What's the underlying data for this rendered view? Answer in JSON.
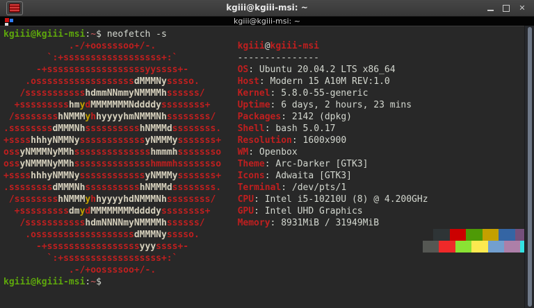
{
  "window": {
    "title": "kgiii@kgiii-msi: ~",
    "controls": {
      "minimize": "minimize",
      "maximize": "maximize",
      "close": "close"
    }
  },
  "tab": {
    "title": "kgiii@kgiii-msi: ~"
  },
  "icons": {
    "app_icon": "red-terminal-app-icon",
    "tab_icon": "terminal-tab-icon",
    "minimize_icon": "minimize-icon",
    "maximize_icon": "maximize-icon",
    "close_icon": "close-icon",
    "scrollbar": "vertical-scrollbar"
  },
  "terminal": {
    "colors": {
      "background": "#282828",
      "red": "#c01f1f",
      "cream": "#d6d0bc",
      "yellow": "#c4a000",
      "green": "#5ea70c",
      "path_color": "#cf5f5f",
      "foreground": "#d3d7cf"
    },
    "prompt": {
      "user_host": "kgiii@kgiii-msi",
      "separator": ":",
      "path": "~",
      "symbol": "$"
    },
    "command": " neofetch -s",
    "ascii_art_rows": [
      [
        [
          "r",
          "            .-/+oossssoo+/-."
        ]
      ],
      [
        [
          "r",
          "        `:+ssssssssssssssssss+:`"
        ]
      ],
      [
        [
          "r",
          "      -+ssssssssssssssssssyyssss+-"
        ]
      ],
      [
        [
          "r",
          "    .ossssssssssssssssss"
        ],
        [
          "w",
          "dMMMNy"
        ],
        [
          "r",
          "sssso."
        ]
      ],
      [
        [
          "r",
          "   /sssssssssss"
        ],
        [
          "w",
          "hdmmNNmmyNMMMMh"
        ],
        [
          "r",
          "ssssss/"
        ]
      ],
      [
        [
          "r",
          "  +sssssssss"
        ],
        [
          "w",
          "hm"
        ],
        [
          "y",
          "y"
        ],
        [
          "r",
          "d"
        ],
        [
          "w",
          "MMMMMMMNddddy"
        ],
        [
          "r",
          "ssssssss+"
        ]
      ],
      [
        [
          "r",
          " /ssssssss"
        ],
        [
          "w",
          "hNMMM"
        ],
        [
          "y",
          "y"
        ],
        [
          "r",
          "h"
        ],
        [
          "w",
          "hyyyyhmNMMMNh"
        ],
        [
          "r",
          "ssssssss/"
        ]
      ],
      [
        [
          "r",
          ".ssssssss"
        ],
        [
          "w",
          "dMMMNh"
        ],
        [
          "r",
          "ssssssssss"
        ],
        [
          "w",
          "hNMMMd"
        ],
        [
          "r",
          "ssssssss."
        ]
      ],
      [
        [
          "r",
          "+ssss"
        ],
        [
          "w",
          "hhhyNMMNy"
        ],
        [
          "r",
          "ssssssssssss"
        ],
        [
          "w",
          "yNMMMy"
        ],
        [
          "r",
          "sssssss+"
        ]
      ],
      [
        [
          "r",
          "oss"
        ],
        [
          "w",
          "yNMMMNyMMh"
        ],
        [
          "r",
          "ssssssssssssss"
        ],
        [
          "w",
          "hmmmh"
        ],
        [
          "r",
          "ssssssso"
        ]
      ],
      [
        [
          "r",
          "oss"
        ],
        [
          "w",
          "yNMMMNyMMh"
        ],
        [
          "r",
          "sssssssssssssshmmmhssssssso"
        ]
      ],
      [
        [
          "r",
          "+ssss"
        ],
        [
          "w",
          "hhhyNMMNy"
        ],
        [
          "r",
          "ssssssssssss"
        ],
        [
          "w",
          "yNMMMy"
        ],
        [
          "r",
          "sssssss+"
        ]
      ],
      [
        [
          "r",
          ".ssssssss"
        ],
        [
          "w",
          "dMMMNh"
        ],
        [
          "r",
          "ssssssssss"
        ],
        [
          "w",
          "hNMMMd"
        ],
        [
          "r",
          "ssssssss."
        ]
      ],
      [
        [
          "r",
          " /ssssssss"
        ],
        [
          "w",
          "hNMMM"
        ],
        [
          "y",
          "y"
        ],
        [
          "r",
          "h"
        ],
        [
          "w",
          "hyyyyhdNMMMNh"
        ],
        [
          "r",
          "ssssssss/"
        ]
      ],
      [
        [
          "r",
          "  +sssssssss"
        ],
        [
          "w",
          "dm"
        ],
        [
          "y",
          "y"
        ],
        [
          "r",
          "d"
        ],
        [
          "w",
          "MMMMMMMMddddy"
        ],
        [
          "r",
          "ssssssss+"
        ]
      ],
      [
        [
          "r",
          "   /sssssssssss"
        ],
        [
          "w",
          "hdmNNNNmyNMMMMh"
        ],
        [
          "r",
          "ssssss/"
        ]
      ],
      [
        [
          "r",
          "    .ossssssssssssssssss"
        ],
        [
          "w",
          "dMMMNy"
        ],
        [
          "r",
          "sssso."
        ]
      ],
      [
        [
          "r",
          "      -+sssssssssssssssss"
        ],
        [
          "w",
          "yyy"
        ],
        [
          "r",
          "ssss+-"
        ]
      ],
      [
        [
          "r",
          "        `:+ssssssssssssssssss+:`"
        ]
      ],
      [
        [
          "r",
          "            .-/+oossssoo+/-."
        ]
      ]
    ],
    "info": {
      "title_user": "kgiii",
      "title_at": "@",
      "title_host": "kgiii-msi",
      "underline": "---------------",
      "label_separator": ":",
      "entries": [
        {
          "label": "OS",
          "value": "Ubuntu 20.04.2 LTS x86_64"
        },
        {
          "label": "Host",
          "value": "Modern 15 A10M REV:1.0"
        },
        {
          "label": "Kernel",
          "value": "5.8.0-55-generic"
        },
        {
          "label": "Uptime",
          "value": "6 days, 2 hours, 23 mins"
        },
        {
          "label": "Packages",
          "value": "2142 (dpkg)"
        },
        {
          "label": "Shell",
          "value": "bash 5.0.17"
        },
        {
          "label": "Resolution",
          "value": "1600x900"
        },
        {
          "label": "WM",
          "value": "Openbox"
        },
        {
          "label": "Theme",
          "value": "Arc-Darker [GTK3]"
        },
        {
          "label": "Icons",
          "value": "Adwaita [GTK3]"
        },
        {
          "label": "Terminal",
          "value": "/dev/pts/1"
        },
        {
          "label": "CPU",
          "value": "Intel i5-10210U (8) @ 4.200GHz"
        },
        {
          "label": "GPU",
          "value": "Intel UHD Graphics"
        },
        {
          "label": "Memory",
          "value": "8931MiB / 31949MiB"
        }
      ]
    },
    "palette_row1": [
      "#2e3436",
      "#cc0000",
      "#4e9a06",
      "#c4a000",
      "#3465a4",
      "#75507b",
      "#06989a",
      "#d3d7cf"
    ],
    "palette_row2": [
      "#555753",
      "#ef2929",
      "#8ae234",
      "#fce94f",
      "#729fcf",
      "#ad7fa8",
      "#34e2e2",
      "#eeeeec"
    ]
  }
}
